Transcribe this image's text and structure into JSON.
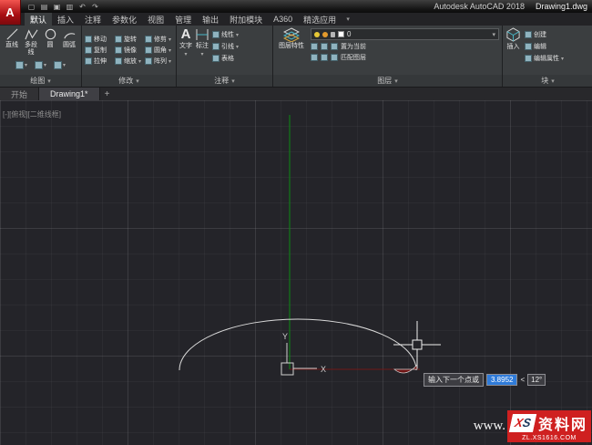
{
  "titlebar": {
    "logo_letter": "A",
    "app_title": "Autodesk AutoCAD 2018",
    "filename": "Drawing1.dwg"
  },
  "tabs": {
    "items": [
      "默认",
      "插入",
      "注释",
      "参数化",
      "视图",
      "管理",
      "输出",
      "附加模块",
      "A360",
      "精选应用"
    ]
  },
  "ribbon": {
    "draw": {
      "label": "绘图",
      "line": "直线",
      "polyline": "多段线",
      "circle": "圆",
      "arc": "圆弧"
    },
    "modify": {
      "label": "修改",
      "items": [
        "移动",
        "旋转",
        "修剪",
        "复制",
        "镜像",
        "圆角",
        "拉伸",
        "缩放",
        "阵列"
      ]
    },
    "annotation": {
      "label": "注释",
      "text": "文字",
      "dimension": "标注",
      "linear": "线性",
      "leader": "引线",
      "table": "表格"
    },
    "layers": {
      "label": "图层",
      "properties": "图层特性",
      "layer_name": "0",
      "set_current": "置为当前",
      "match": "匹配图层"
    },
    "block": {
      "label": "块",
      "insert": "插入",
      "create": "创建",
      "edit": "编辑",
      "edit_attr": "编辑属性"
    }
  },
  "file_tabs": {
    "start": "开始",
    "drawing": "Drawing1*",
    "add": "+"
  },
  "canvas": {
    "viewport_controls": "[-][俯视][二维线框]",
    "ucs": {
      "x": "X",
      "y": "Y"
    },
    "dyn_input": {
      "prompt": "输入下一个点或",
      "value": "3.8952",
      "angle_sign": "<",
      "angle": "12°"
    }
  },
  "watermark": {
    "www": "www.",
    "logo_x": "X",
    "logo_s": "S",
    "name": "资料网",
    "url": "ZL.XS1616.COM"
  },
  "colors": {
    "axis_green": "#0c8a12",
    "axis_red": "#701818",
    "curve": "#d9d9d9",
    "selection_blue": "#2f7bd9",
    "logo_red": "#a90d12",
    "watermark_red": "#cf2020"
  }
}
